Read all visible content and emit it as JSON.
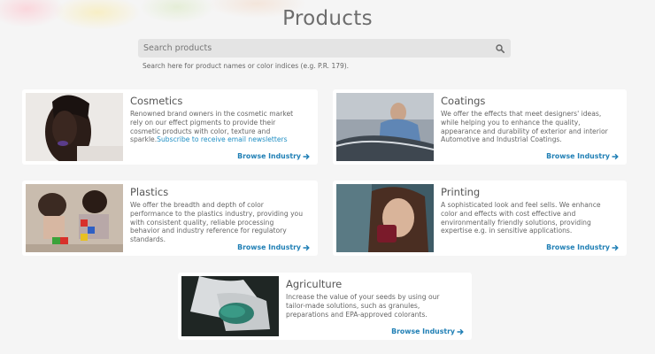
{
  "page": {
    "title": "Products"
  },
  "search": {
    "placeholder": "Search products",
    "hint": "Search here for product names or color indices (e.g. P.R. 179).",
    "icon": "search-icon"
  },
  "industries": [
    {
      "title": "Cosmetics",
      "description": "Renowned brand owners in the cosmetic market rely on our effect pigments to provide their cosmetic products with color, texture and sparkle.",
      "link_text": "Subscribe to receive email newsletters",
      "browse_label": "Browse Industry"
    },
    {
      "title": "Coatings",
      "description": "We offer the effects that meet designers' ideas, while helping you to enhance the quality, appearance and durability of exterior and interior Automotive and Industrial Coatings.",
      "browse_label": "Browse Industry"
    },
    {
      "title": "Plastics",
      "description": "We offer the breadth and depth of color performance to the plastics industry, providing you with consistent quality, reliable processing behavior and industry reference for regulatory standards.",
      "browse_label": "Browse Industry"
    },
    {
      "title": "Printing",
      "description": "A sophisticated look and feel sells. We enhance color and effects with cost effective and environmentally friendly solutions, providing expertise e.g. in sensitive applications.",
      "browse_label": "Browse Industry"
    },
    {
      "title": "Agriculture",
      "description": "Increase the value of your seeds by using our tailor-made solutions, such as granules, preparations and EPA-approved colorants.",
      "browse_label": "Browse Industry"
    }
  ],
  "colors": {
    "link": "#1f8fc4",
    "browse": "#1f7fb5",
    "card_bg": "#ffffff",
    "page_bg": "#f5f5f5"
  }
}
